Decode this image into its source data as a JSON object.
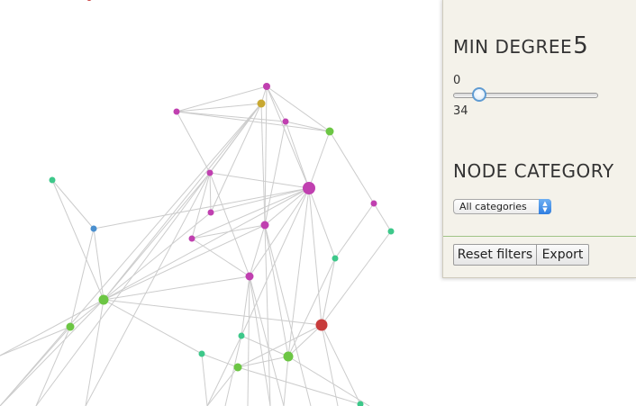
{
  "filters": {
    "min_degree": {
      "title": "MIN DEGREE",
      "value": "5",
      "range_min": "0",
      "range_max": "34",
      "slider_fraction": 0.147
    },
    "node_category": {
      "title": "NODE CATEGORY",
      "selected": "All categories"
    },
    "buttons": {
      "reset_label": "Reset filters",
      "export_label": "Export"
    }
  },
  "colors": {
    "edge": "#cccccc",
    "node_magenta": "#c040b0",
    "node_green": "#6cc644",
    "node_teal": "#3dc88a",
    "node_blue": "#4a8fcf",
    "node_olive": "#c8a832",
    "node_red": "#c83c3c",
    "slider_accent": "#5f9bd2"
  }
}
